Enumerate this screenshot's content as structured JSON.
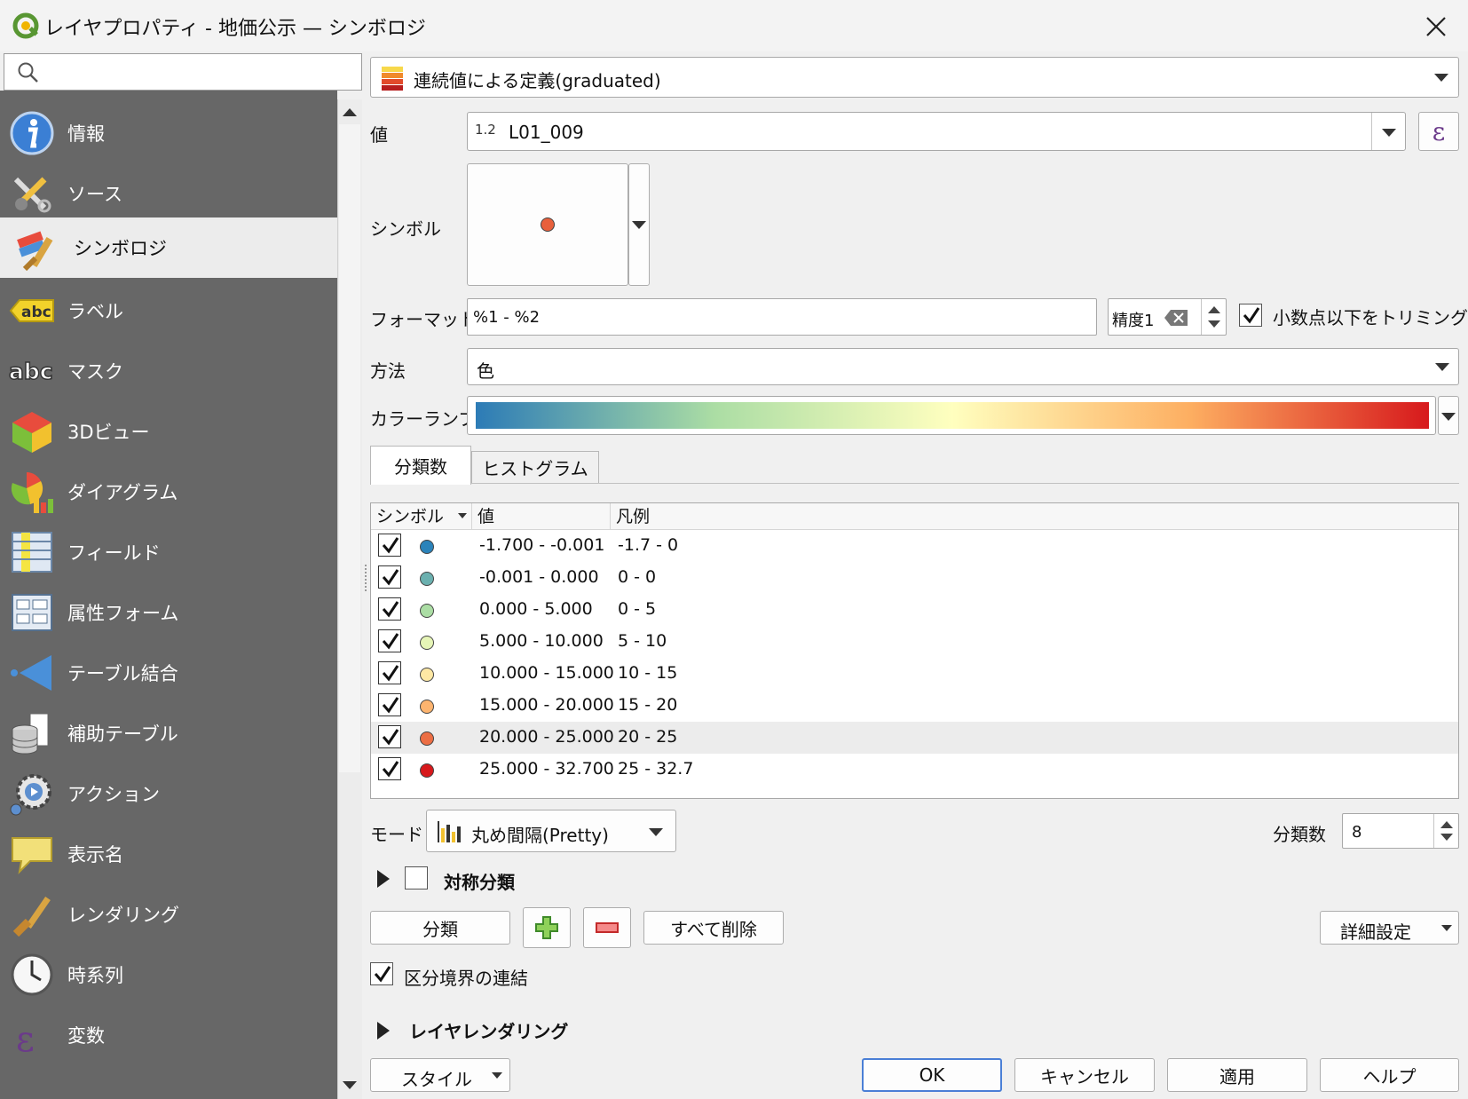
{
  "window": {
    "title": "レイヤプロパティ - 地価公示 — シンボロジ"
  },
  "search": {
    "placeholder": ""
  },
  "sidebar": {
    "items": [
      {
        "label": "情報",
        "icon": "info-icon"
      },
      {
        "label": "ソース",
        "icon": "source-tools-icon"
      },
      {
        "label": "シンボロジ",
        "icon": "symbology-brush-icon",
        "active": true
      },
      {
        "label": "ラベル",
        "icon": "label-abc-icon"
      },
      {
        "label": "マスク",
        "icon": "mask-abc-icon"
      },
      {
        "label": "3Dビュー",
        "icon": "3d-cube-icon"
      },
      {
        "label": "ダイアグラム",
        "icon": "diagram-icon"
      },
      {
        "label": "フィールド",
        "icon": "fields-icon"
      },
      {
        "label": "属性フォーム",
        "icon": "attribute-form-icon"
      },
      {
        "label": "テーブル結合",
        "icon": "join-icon"
      },
      {
        "label": "補助テーブル",
        "icon": "auxiliary-storage-icon"
      },
      {
        "label": "アクション",
        "icon": "actions-gear-icon"
      },
      {
        "label": "表示名",
        "icon": "display-name-bubble-icon"
      },
      {
        "label": "レンダリング",
        "icon": "rendering-brush-icon"
      },
      {
        "label": "時系列",
        "icon": "temporal-clock-icon"
      },
      {
        "label": "変数",
        "icon": "variables-epsilon-icon"
      }
    ]
  },
  "renderer": {
    "selected": "連続値による定義(graduated)"
  },
  "value": {
    "label": "値",
    "type_badge": "1.2",
    "field": "L01_009"
  },
  "symbol": {
    "label": "シンボル",
    "color": "#e8603c"
  },
  "format": {
    "label": "フォーマット",
    "value": "%1 - %2",
    "precision": "精度1",
    "trim_label": "小数点以下をトリミング",
    "trim_checked": true
  },
  "method": {
    "label": "方法",
    "value": "色"
  },
  "color_ramp": {
    "label": "カラーランプ",
    "stops": [
      "#2c7bb6",
      "#abdda4",
      "#ffffbf",
      "#fdae61",
      "#d7191c"
    ]
  },
  "tabs": {
    "classes": "分類数",
    "histogram": "ヒストグラム"
  },
  "table": {
    "headers": {
      "symbol": "シンボル",
      "values": "値",
      "legend": "凡例"
    },
    "rows": [
      {
        "values": "-1.700 - -0.001",
        "legend": "-1.7 - 0",
        "color": "#2b83ba",
        "checked": true
      },
      {
        "values": "-0.001 - 0.000",
        "legend": "0 - 0",
        "color": "#6bb0af",
        "checked": true
      },
      {
        "values": "0.000 - 5.000",
        "legend": "0 - 5",
        "color": "#abdda4",
        "checked": true
      },
      {
        "values": "5.000 - 10.000",
        "legend": "5 - 10",
        "color": "#e6f5b7",
        "checked": true
      },
      {
        "values": "10.000 - 15.000",
        "legend": "10 - 15",
        "color": "#fee8a4",
        "checked": true
      },
      {
        "values": "15.000 - 20.000",
        "legend": "15 - 20",
        "color": "#fdb46f",
        "checked": true
      },
      {
        "values": "20.000 - 25.000",
        "legend": "20 - 25",
        "color": "#ec6e44",
        "checked": true,
        "selected": true
      },
      {
        "values": "25.000 - 32.700",
        "legend": "25 - 32.7",
        "color": "#d7191c",
        "checked": true
      }
    ]
  },
  "mode": {
    "label": "モード",
    "value": "丸め間隔(Pretty)"
  },
  "classes_count": {
    "label": "分類数",
    "value": "8"
  },
  "symmetric": {
    "label": "対称分類",
    "checked": false
  },
  "buttons": {
    "classify": "分類",
    "delete_all": "すべて削除",
    "advanced": "詳細設定"
  },
  "link_boundaries": {
    "label": "区分境界の連結",
    "checked": true
  },
  "layer_rendering": {
    "label": "レイヤレンダリング"
  },
  "footer": {
    "style": "スタイル",
    "ok": "OK",
    "cancel": "キャンセル",
    "apply": "適用",
    "help": "ヘルプ"
  }
}
